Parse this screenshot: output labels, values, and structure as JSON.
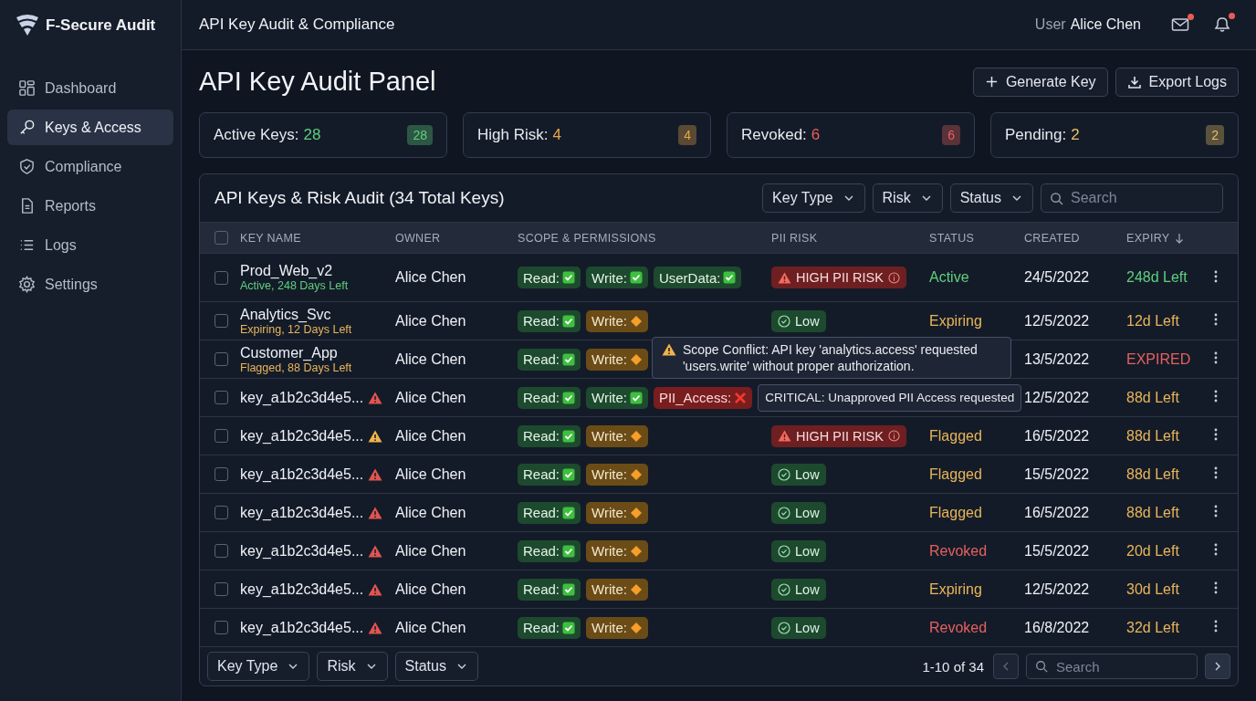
{
  "app": {
    "name": "F-Secure Audit"
  },
  "sidebar": {
    "items": [
      {
        "label": "Dashboard",
        "selected": false
      },
      {
        "label": "Keys & Access",
        "selected": true
      },
      {
        "label": "Compliance",
        "selected": false
      },
      {
        "label": "Reports",
        "selected": false
      },
      {
        "label": "Logs",
        "selected": false
      },
      {
        "label": "Settings",
        "selected": false
      }
    ]
  },
  "header": {
    "title": "API Key Audit & Compliance",
    "user_label": "User",
    "user_name": "Alice Chen",
    "mail_unread": true,
    "bell_unread": true
  },
  "page": {
    "title": "API Key Audit Panel",
    "buttons": [
      "Generate Key",
      "Export Logs"
    ]
  },
  "stats": [
    {
      "label": "Active Keys:",
      "value": "28",
      "badge": "28",
      "color": "#5fcf7f"
    },
    {
      "label": "High Risk:",
      "value": "4",
      "badge": "4",
      "color": "#e8a64a"
    },
    {
      "label": "Revoked:",
      "value": "6",
      "badge": "6",
      "color": "#e5605f"
    },
    {
      "label": "Pending:",
      "value": "2",
      "badge": "2",
      "color": "#e8c06a"
    }
  ],
  "table": {
    "title": "API Keys & Risk Audit (34 Total Keys)",
    "filters": [
      "Key Type",
      "Risk",
      "Status"
    ],
    "search": {
      "placeholder": "Search"
    },
    "all_checked": false,
    "columns": [
      {
        "label": "KEY NAME",
        "sorted": false
      },
      {
        "label": "OWNER",
        "sorted": false
      },
      {
        "label": "SCOPE & PERMISSIONS",
        "sorted": false
      },
      {
        "label": "PII RISK",
        "sorted": false
      },
      {
        "label": "STATUS",
        "sorted": false
      },
      {
        "label": "CREATED",
        "sorted": false
      },
      {
        "label": "EXPIRY",
        "sorted": true
      }
    ],
    "rows": [
      {
        "name": "Prod_Web_v2",
        "sub": {
          "text": "Active, 248 Days Left",
          "color": "#5fcf7f"
        },
        "owner": "Alice Chen",
        "scopes": [
          {
            "label": "Read:",
            "kind": "ok"
          },
          {
            "label": "Write:",
            "kind": "ok"
          },
          {
            "label": "UserData:",
            "kind": "ok"
          }
        ],
        "pii": {
          "kind": "high",
          "label": "HIGH PII RISK"
        },
        "status": {
          "text": "Active",
          "color": "#5fcf7f"
        },
        "created": "24/5/2022",
        "expiry": {
          "text": "248d Left",
          "color": "#5fcf7f"
        },
        "checked": false
      },
      {
        "name": "Analytics_Svc",
        "sub": {
          "text": "Expiring, 12 Days Left",
          "color": "#e8b55a"
        },
        "owner": "Alice Chen",
        "scopes": [
          {
            "label": "Read:",
            "kind": "ok"
          },
          {
            "label": "Write:",
            "kind": "warn"
          }
        ],
        "pii": {
          "kind": "low",
          "label": "Low"
        },
        "status": {
          "text": "Expiring",
          "color": "#e8b55a"
        },
        "created": "12/5/2022",
        "expiry": {
          "text": "12d Left",
          "color": "#e8b55a"
        },
        "checked": false
      },
      {
        "name": "Customer_App",
        "sub": {
          "text": "Flagged, 88 Days Left",
          "color": "#e8b55a"
        },
        "owner": "Alice Chen",
        "scopes": [
          {
            "label": "Read:",
            "kind": "ok"
          },
          {
            "label": "Write:",
            "kind": "warn"
          }
        ],
        "tooltip": {
          "text": "Scope Conflict: API key 'analytics.access' requested 'users.write' without proper authorization.",
          "kind": "warning"
        },
        "created": "13/5/2022",
        "expiry": {
          "text": "EXPIRED",
          "color": "#e5605f"
        },
        "checked": false
      },
      {
        "name": "key_a1b2c3d4e5...",
        "warning": {
          "color": "#e0554f"
        },
        "owner": "Alice Chen",
        "scopes": [
          {
            "label": "Read:",
            "kind": "ok"
          },
          {
            "label": "Write:",
            "kind": "ok"
          },
          {
            "label": "PII_Access:",
            "kind": "denied"
          }
        ],
        "tooltip": {
          "text": "CRITICAL: Unapproved PII Access requested",
          "kind": "plain"
        },
        "created": "12/5/2022",
        "expiry": {
          "text": "88d Left",
          "color": "#e8b55a"
        },
        "checked": false
      },
      {
        "name": "key_a1b2c3d4e5...",
        "warning": {
          "color": "#f0b44a"
        },
        "owner": "Alice Chen",
        "scopes": [
          {
            "label": "Read:",
            "kind": "ok"
          },
          {
            "label": "Write:",
            "kind": "warn"
          }
        ],
        "pii": {
          "kind": "high",
          "label": "HIGH PII RISK"
        },
        "status": {
          "text": "Flagged",
          "color": "#e8b55a"
        },
        "created": "16/5/2022",
        "expiry": {
          "text": "88d Left",
          "color": "#e8b55a"
        },
        "checked": false
      },
      {
        "name": "key_a1b2c3d4e5...",
        "warning": {
          "color": "#e0554f"
        },
        "owner": "Alice Chen",
        "scopes": [
          {
            "label": "Read:",
            "kind": "ok"
          },
          {
            "label": "Write:",
            "kind": "warn"
          }
        ],
        "pii": {
          "kind": "low",
          "label": "Low"
        },
        "status": {
          "text": "Flagged",
          "color": "#e8b55a"
        },
        "created": "15/5/2022",
        "expiry": {
          "text": "88d Left",
          "color": "#e8b55a"
        },
        "checked": false
      },
      {
        "name": "key_a1b2c3d4e5...",
        "warning": {
          "color": "#e0554f"
        },
        "owner": "Alice Chen",
        "scopes": [
          {
            "label": "Read:",
            "kind": "ok"
          },
          {
            "label": "Write:",
            "kind": "warn"
          }
        ],
        "pii": {
          "kind": "low",
          "label": "Low"
        },
        "status": {
          "text": "Flagged",
          "color": "#e8b55a"
        },
        "created": "16/5/2022",
        "expiry": {
          "text": "88d Left",
          "color": "#e8b55a"
        },
        "checked": false
      },
      {
        "name": "key_a1b2c3d4e5...",
        "warning": {
          "color": "#e0554f"
        },
        "owner": "Alice Chen",
        "scopes": [
          {
            "label": "Read:",
            "kind": "ok"
          },
          {
            "label": "Write:",
            "kind": "warn"
          }
        ],
        "pii": {
          "kind": "low",
          "label": "Low"
        },
        "status": {
          "text": "Revoked",
          "color": "#e5605f"
        },
        "created": "15/5/2022",
        "expiry": {
          "text": "20d Left",
          "color": "#e8b55a"
        },
        "checked": false
      },
      {
        "name": "key_a1b2c3d4e5...",
        "warning": {
          "color": "#e0554f"
        },
        "owner": "Alice Chen",
        "scopes": [
          {
            "label": "Read:",
            "kind": "ok"
          },
          {
            "label": "Write:",
            "kind": "warn"
          }
        ],
        "pii": {
          "kind": "low",
          "label": "Low"
        },
        "status": {
          "text": "Expiring",
          "color": "#e8b55a"
        },
        "created": "12/5/2022",
        "expiry": {
          "text": "30d Left",
          "color": "#e8b55a"
        },
        "checked": false
      },
      {
        "name": "key_a1b2c3d4e5...",
        "warning": {
          "color": "#e0554f"
        },
        "owner": "Alice Chen",
        "scopes": [
          {
            "label": "Read:",
            "kind": "ok"
          },
          {
            "label": "Write:",
            "kind": "warn"
          }
        ],
        "pii": {
          "kind": "low",
          "label": "Low"
        },
        "status": {
          "text": "Revoked",
          "color": "#e5605f"
        },
        "created": "16/8/2022",
        "expiry": {
          "text": "32d Left",
          "color": "#e8b55a"
        },
        "checked": false
      }
    ],
    "footer": {
      "filters": [
        "Key Type",
        "Risk",
        "Status"
      ],
      "range": "1-10 of 34",
      "prev_disabled": true,
      "next_disabled": false,
      "search": {
        "placeholder": "Search"
      }
    }
  }
}
